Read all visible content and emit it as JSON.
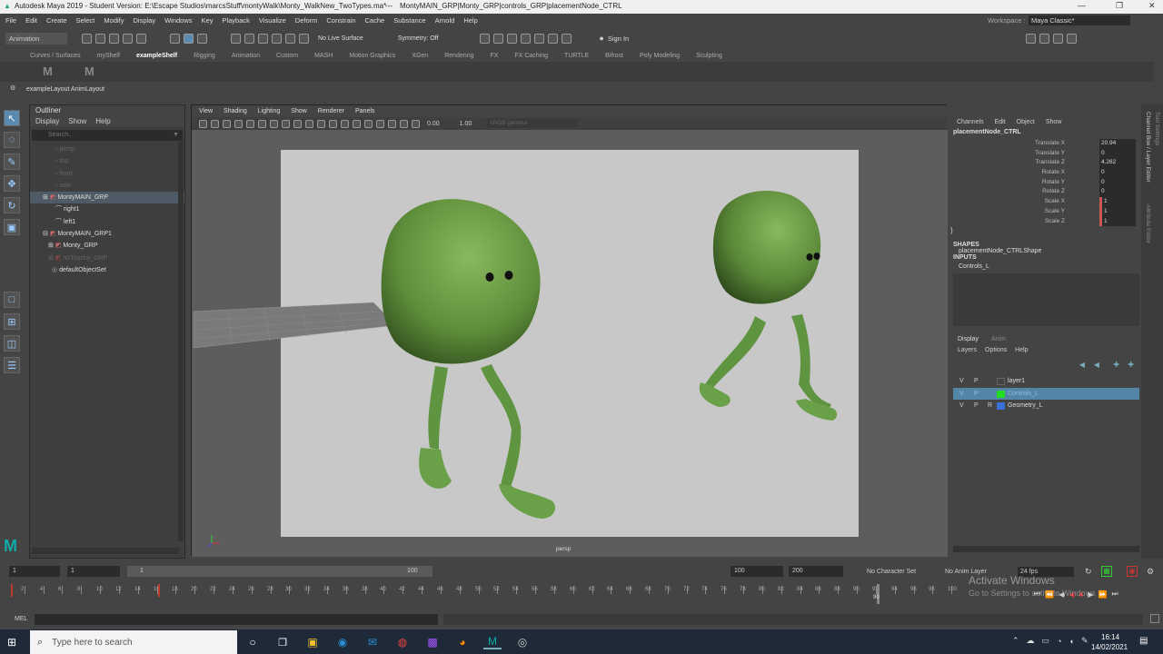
{
  "window": {
    "title": "Autodesk Maya 2019 - Student Version: E:\\Escape Studios\\marcsStuff\\montyWalk\\Monty_WalkNew_TwoTypes.ma*",
    "separator": "---",
    "selection_path": "MontyMAIN_GRP|Monty_GRP|controls_GRP|placementNode_CTRL"
  },
  "menubar": {
    "items": [
      "File",
      "Edit",
      "Create",
      "Select",
      "Modify",
      "Display",
      "Windows",
      "Key",
      "Playback",
      "Visualize",
      "Deform",
      "Constrain",
      "Cache",
      "Substance",
      "Arnold",
      "Help"
    ],
    "workspace_label": "Workspace :",
    "workspace_value": "Maya Classic*"
  },
  "statusline": {
    "menuset": "Animation",
    "live_surface": "No Live Surface",
    "symmetry": "Symmetry: Off",
    "sign_in": "Sign In"
  },
  "shelf": {
    "tabs": [
      "Curves / Surfaces",
      "myShelf",
      "exampleShelf",
      "Rigging",
      "Animation",
      "Custom",
      "MASH",
      "Motion Graphics",
      "XGen",
      "Rendering",
      "FX",
      "FX Caching",
      "TURTLE",
      "Bifrost",
      "Poly Modeling",
      "Sculpting"
    ],
    "active_tab": "exampleShelf",
    "buttons": [
      "M",
      "M"
    ]
  },
  "layout_label": "exampleLayout AnimLayout",
  "outliner": {
    "title": "Outliner",
    "menu": [
      "Display",
      "Show",
      "Help"
    ],
    "search_placeholder": "Search...",
    "items": [
      {
        "label": "persp",
        "dim": true,
        "indent": 0
      },
      {
        "label": "top",
        "dim": true,
        "indent": 0
      },
      {
        "label": "front",
        "dim": true,
        "indent": 0
      },
      {
        "label": "side",
        "dim": true,
        "indent": 0
      },
      {
        "label": "MontyMAIN_GRP",
        "dim": false,
        "indent": 0,
        "selected": true
      },
      {
        "label": "right1",
        "dim": false,
        "indent": 0
      },
      {
        "label": "left1",
        "dim": false,
        "indent": 0
      },
      {
        "label": "MontyMAIN_GRP1",
        "dim": false,
        "indent": 0
      },
      {
        "label": "Monty_GRP",
        "dim": false,
        "indent": 1
      },
      {
        "label": "noTouchy_GRP",
        "dim": true,
        "indent": 1
      },
      {
        "label": "defaultObjectSet",
        "dim": false,
        "indent": 0
      }
    ]
  },
  "viewport": {
    "menu": [
      "View",
      "Shading",
      "Lighting",
      "Show",
      "Renderer",
      "Panels"
    ],
    "near": "0.00",
    "far": "1.00",
    "color_space": "sRGB gamma",
    "camera": "persp"
  },
  "channels": {
    "menu": [
      "Channels",
      "Edit",
      "Object",
      "Show"
    ],
    "node": "placementNode_CTRL",
    "attrs": [
      {
        "name": "Translate X",
        "value": "20.94"
      },
      {
        "name": "Translate Y",
        "value": "0"
      },
      {
        "name": "Translate Z",
        "value": "4.262"
      },
      {
        "name": "Rotate X",
        "value": "0"
      },
      {
        "name": "Rotate Y",
        "value": "0"
      },
      {
        "name": "Rotate Z",
        "value": "0"
      },
      {
        "name": "Scale X",
        "value": "1"
      },
      {
        "name": "Scale Y",
        "value": "1"
      },
      {
        "name": "Scale Z",
        "value": "1"
      }
    ],
    "shapes_label": "SHAPES",
    "shape_node": "placementNode_CTRLShape",
    "inputs_label": "INPUTS",
    "input_node": "Controls_L"
  },
  "layers": {
    "tabs": [
      "Display",
      "Anim"
    ],
    "menu": [
      "Layers",
      "Options",
      "Help"
    ],
    "rows": [
      {
        "v": "V",
        "p": "P",
        "r": "",
        "name": "layer1",
        "color": "#444444",
        "selected": false
      },
      {
        "v": "V",
        "p": "P",
        "r": "",
        "name": "Controls_L",
        "color": "#22dd22",
        "selected": true
      },
      {
        "v": "V",
        "p": "P",
        "r": "R",
        "name": "Geometry_L",
        "color": "#3a6fd8",
        "selected": false
      }
    ]
  },
  "side_tabs": [
    "Channel Box / Layer Editor",
    "Attribute Editor",
    "Tool Settings"
  ],
  "timeline": {
    "ticks": [
      "2",
      "4",
      "6",
      "8",
      "10",
      "12",
      "14",
      "16",
      "18",
      "20",
      "22",
      "24",
      "26",
      "28",
      "30",
      "32",
      "34",
      "36",
      "38",
      "40",
      "42",
      "44",
      "46",
      "48",
      "50",
      "52",
      "54",
      "56",
      "58",
      "60",
      "62",
      "64",
      "66",
      "68",
      "70",
      "72",
      "74",
      "76",
      "78",
      "80",
      "82",
      "84",
      "86",
      "88",
      "90",
      "92",
      "94",
      "96",
      "98",
      "100"
    ],
    "current_frame": "90",
    "range_start": "1",
    "playback_start": "1",
    "slider_start": "1",
    "slider_end": "100",
    "anim_end": "100",
    "max_end": "200",
    "character_set": "No Character Set",
    "anim_layer": "No Anim Layer",
    "fps": "24 fps"
  },
  "cmdline": {
    "label": "MEL"
  },
  "watermark": {
    "line1": "Activate Windows",
    "line2": "Go to Settings to activate Windows."
  },
  "taskbar": {
    "search_placeholder": "Type here to search",
    "time": "16:14",
    "date": "14/02/2021"
  },
  "colors": {
    "char_green": "#6b9e45",
    "selection_blue": "#5285a6",
    "timeline_red": "#c0392b"
  }
}
